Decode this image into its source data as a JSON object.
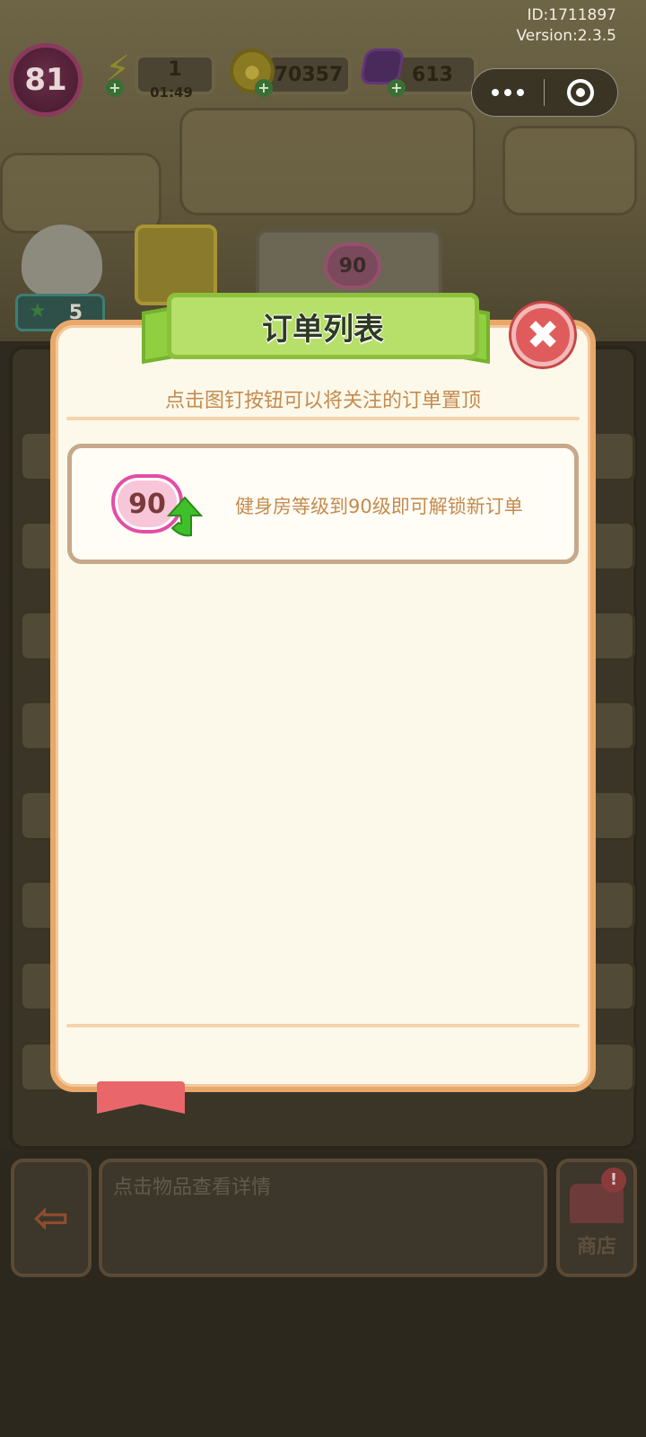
{
  "meta": {
    "id_text": "ID:1711897",
    "version_text": "Version:2.3.5"
  },
  "hud": {
    "player_level": "81",
    "energy_value": "1",
    "energy_timer": "01:49",
    "coins_value": "70357",
    "gems_value": "613"
  },
  "capsule": {
    "more_icon": "more-dots-icon",
    "close_icon": "target-circle-icon"
  },
  "background": {
    "character_count": "5",
    "mid_card_level": "90",
    "detail_placeholder": "点击物品查看详情",
    "shop_label": "商店",
    "shop_badge": "!"
  },
  "modal": {
    "title": "订单列表",
    "close_glyph": "✖",
    "hint": "点击图钉按钮可以将关注的订单置顶",
    "orders": [
      {
        "level": "90",
        "text": "健身房等级到90级即可解锁新订单"
      }
    ]
  },
  "colors": {
    "modal_bg": "#fcf9ea",
    "modal_border": "#e7a86a",
    "title_banner": "#b6e06a",
    "close_red": "#e05c5c",
    "hint_text": "#c58a4e",
    "heart_pink": "#e24ea6",
    "arrow_green": "#3fbf2a"
  }
}
